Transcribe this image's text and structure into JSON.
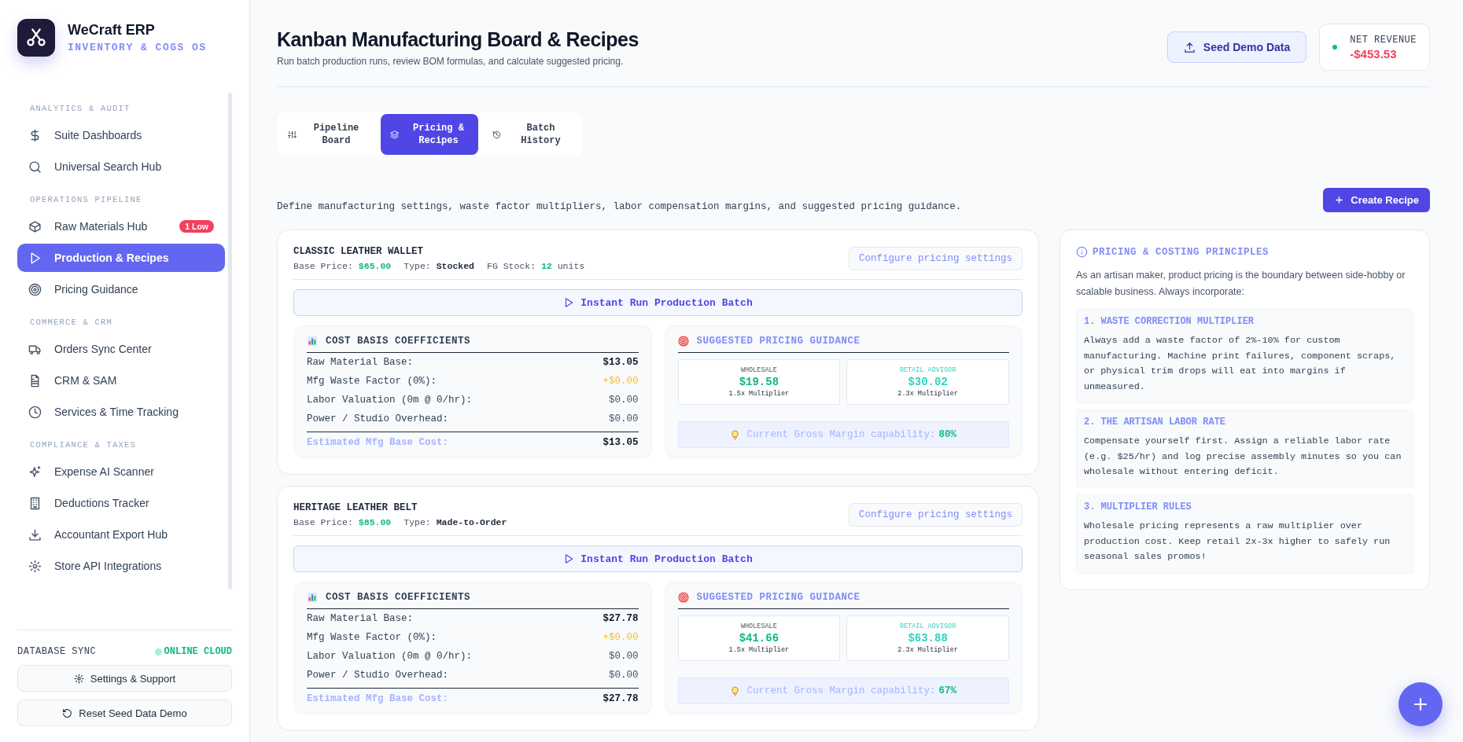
{
  "sidebar": {
    "brand": {
      "name": "WeCraft ERP",
      "subtitle": "INVENTORY & COGS OS"
    },
    "sections": [
      {
        "title": "ANALYTICS & AUDIT",
        "items": [
          {
            "label": "Suite Dashboards",
            "kind": "dollar",
            "selected": false
          },
          {
            "label": "Universal Search Hub",
            "kind": "search",
            "selected": false
          }
        ]
      },
      {
        "title": "OPERATIONS PIPELINE",
        "items": [
          {
            "label": "Raw Materials Hub",
            "kind": "box",
            "selected": false,
            "badge": "1 Low"
          },
          {
            "label": "Production & Recipes",
            "kind": "play",
            "selected": true
          },
          {
            "label": "Pricing Guidance",
            "kind": "target",
            "selected": false
          }
        ]
      },
      {
        "title": "COMMERCE & CRM",
        "items": [
          {
            "label": "Orders Sync Center",
            "kind": "truck",
            "selected": false
          },
          {
            "label": "CRM & SAM",
            "kind": "file",
            "selected": false
          },
          {
            "label": "Services & Time Tracking",
            "kind": "clock",
            "selected": false
          }
        ]
      },
      {
        "title": "COMPLIANCE & TAXES",
        "items": [
          {
            "label": "Expense AI Scanner",
            "kind": "sparkle",
            "selected": false
          },
          {
            "label": "Deductions Tracker",
            "kind": "building",
            "selected": false
          },
          {
            "label": "Accountant Export Hub",
            "kind": "download",
            "selected": false
          },
          {
            "label": "Store API Integrations",
            "kind": "gear",
            "selected": false
          }
        ]
      }
    ],
    "sync": {
      "label": "DATABASE SYNC",
      "status": "ONLINE CLOUD",
      "online": true
    },
    "buttons": [
      {
        "label": "Settings & Support",
        "kind": "gear"
      },
      {
        "label": "Reset Seed Data Demo",
        "kind": "refresh"
      }
    ]
  },
  "header": {
    "title": "Kanban Manufacturing Board & Recipes",
    "subtitle": "Run batch production runs, review BOM formulas, and calculate suggested pricing.",
    "seed_button": "Seed Demo Data",
    "net_revenue": {
      "label": "NET REVENUE",
      "value": "-$453.53"
    }
  },
  "tabs": [
    {
      "label": "Pipeline Board",
      "kind": "sliders",
      "selected": false
    },
    {
      "label": "Pricing & Recipes",
      "kind": "layers",
      "selected": true
    },
    {
      "label": "Batch History",
      "kind": "history",
      "selected": false
    }
  ],
  "section": {
    "description": "Define manufacturing settings, waste factor multipliers, labor compensation margins, and suggested pricing guidance.",
    "create_button": "Create Recipe"
  },
  "recipes": [
    {
      "name": "CLASSIC LEATHER WALLET",
      "meta": [
        {
          "label": "Base Price:",
          "value": "$65.00",
          "kind": "price"
        },
        {
          "label": "Type:",
          "value": "Stocked",
          "kind": "plain"
        },
        {
          "label": "FG Stock:",
          "value": "12",
          "unit": "units",
          "kind": "count"
        }
      ],
      "configure_button": "Configure pricing settings",
      "run_button": "Instant Run Production Batch",
      "cost": {
        "title": "COST BASIS COEFFICIENTS",
        "rows": [
          {
            "label": "Raw Material Base:",
            "value": "$13.05",
            "kind": "strong"
          },
          {
            "label": "Mfg Waste Factor (0%):",
            "value": "+$0.00",
            "kind": "warning"
          },
          {
            "label": "Labor Valuation (0m @ 0/hr):",
            "value": "$0.00",
            "kind": "muted"
          },
          {
            "label": "Power / Studio Overhead:",
            "value": "$0.00",
            "kind": "muted"
          }
        ],
        "total": {
          "label": "Estimated Mfg Base Cost:",
          "value": "$13.05"
        }
      },
      "pricing": {
        "title": "SUGGESTED PRICING GUIDANCE",
        "tiers": [
          {
            "label": "WHOLESALE",
            "value": "$19.58",
            "note": "1.5x Multiplier",
            "kind": "wholesale"
          },
          {
            "label": "RETAIL ADVISOR",
            "value": "$30.02",
            "note": "2.3x Multiplier",
            "kind": "retail"
          }
        ],
        "margin": {
          "label": "Current Gross Margin capability:",
          "value": "80%"
        }
      }
    },
    {
      "name": "HERITAGE LEATHER BELT",
      "meta": [
        {
          "label": "Base Price:",
          "value": "$85.00",
          "kind": "price"
        },
        {
          "label": "Type:",
          "value": "Made-to-Order",
          "kind": "plain"
        }
      ],
      "configure_button": "Configure pricing settings",
      "run_button": "Instant Run Production Batch",
      "cost": {
        "title": "COST BASIS COEFFICIENTS",
        "rows": [
          {
            "label": "Raw Material Base:",
            "value": "$27.78",
            "kind": "strong"
          },
          {
            "label": "Mfg Waste Factor (0%):",
            "value": "+$0.00",
            "kind": "warning"
          },
          {
            "label": "Labor Valuation (0m @ 0/hr):",
            "value": "$0.00",
            "kind": "muted"
          },
          {
            "label": "Power / Studio Overhead:",
            "value": "$0.00",
            "kind": "muted"
          }
        ],
        "total": {
          "label": "Estimated Mfg Base Cost:",
          "value": "$27.78"
        }
      },
      "pricing": {
        "title": "SUGGESTED PRICING GUIDANCE",
        "tiers": [
          {
            "label": "WHOLESALE",
            "value": "$41.66",
            "note": "1.5x Multiplier",
            "kind": "wholesale"
          },
          {
            "label": "RETAIL ADVISOR",
            "value": "$63.88",
            "note": "2.3x Multiplier",
            "kind": "retail"
          }
        ],
        "margin": {
          "label": "Current Gross Margin capability:",
          "value": "67%"
        }
      }
    }
  ],
  "principles": {
    "title": "PRICING & COSTING PRINCIPLES",
    "intro": "As an artisan maker, product pricing is the boundary between side-hobby or scalable business. Always incorporate:",
    "items": [
      {
        "title": "1. WASTE CORRECTION MULTIPLIER",
        "body": "Always add a waste factor of 2%-10% for custom manufacturing. Machine print failures, component scraps, or physical trim drops will eat into margins if unmeasured."
      },
      {
        "title": "2. THE ARTISAN LABOR RATE",
        "body": "Compensate yourself first. Assign a reliable labor rate (e.g. $25/hr) and log precise assembly minutes so you can wholesale without entering deficit."
      },
      {
        "title": "3. MULTIPLIER RULES",
        "body": "Wholesale pricing represents a raw multiplier over production cost. Keep retail 2x-3x higher to safely run seasonal sales promos!"
      }
    ]
  }
}
